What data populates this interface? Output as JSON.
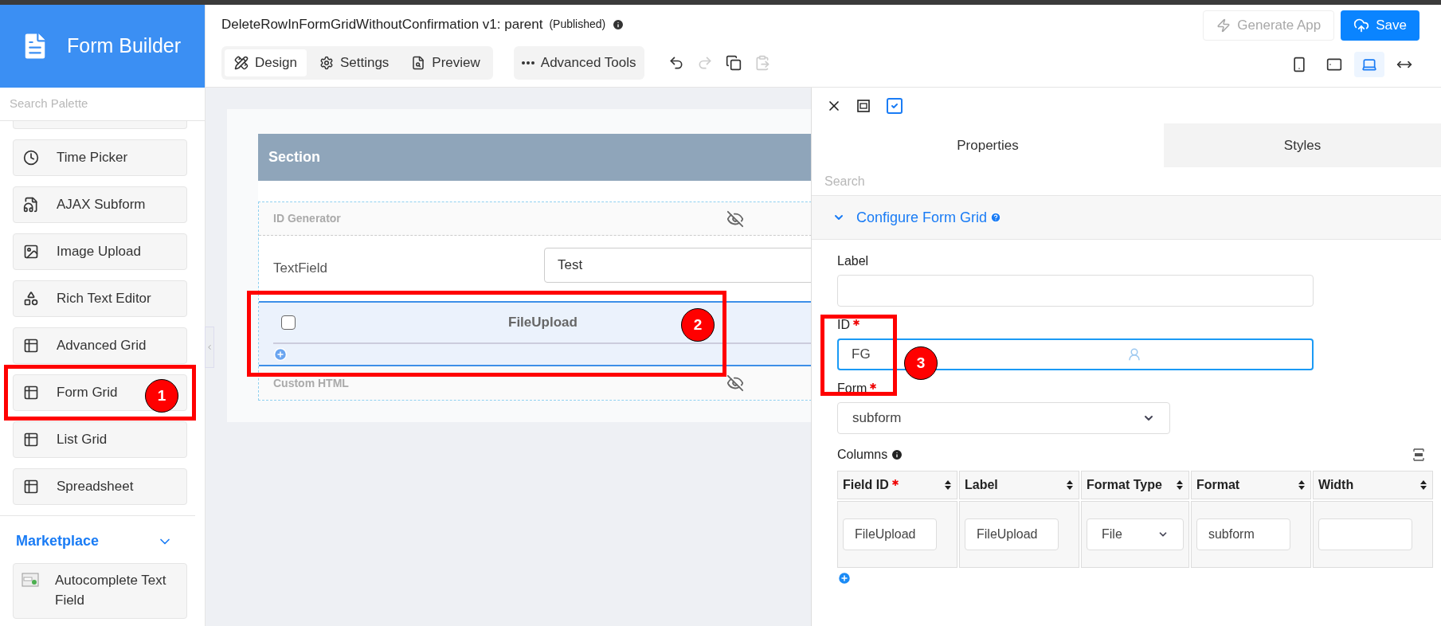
{
  "header": {
    "app_name": "Form Builder",
    "title": "DeleteRowInFormGridWithoutConfirmation v1: parent",
    "status": "(Published)"
  },
  "mode_tabs": [
    {
      "label": "Design",
      "selected": true
    },
    {
      "label": "Settings",
      "selected": false
    },
    {
      "label": "Preview",
      "selected": false
    }
  ],
  "advanced_tools": "Advanced Tools",
  "history_tools": [
    {
      "disabled": false
    },
    {
      "disabled": true
    },
    {
      "disabled": false
    },
    {
      "disabled": true
    }
  ],
  "actions": [
    {
      "label": "Generate App",
      "kind": "generate",
      "disabled": true
    },
    {
      "label": "Save",
      "kind": "save",
      "disabled": false
    }
  ],
  "devices": [
    {
      "selected": false
    },
    {
      "selected": false
    },
    {
      "selected": true
    },
    {
      "selected": false
    }
  ],
  "palette": {
    "search_placeholder": "Search Palette",
    "items": [
      {
        "label": "Time Picker"
      },
      {
        "label": "AJAX Subform"
      },
      {
        "label": "Image Upload"
      },
      {
        "label": "Rich Text Editor"
      },
      {
        "label": "Advanced Grid"
      },
      {
        "label": "Form Grid"
      },
      {
        "label": "List Grid"
      },
      {
        "label": "Spreadsheet"
      }
    ],
    "marketplace": {
      "title": "Marketplace",
      "expanded": true,
      "items": [
        {
          "label": "Autocomplete Text Field"
        }
      ]
    }
  },
  "canvas": {
    "section_title": "Section",
    "fields": [
      {
        "kind": "hidden",
        "label": "ID Generator"
      },
      {
        "kind": "text",
        "label": "TextField",
        "value": "Test"
      },
      {
        "kind": "grid",
        "label": "FileUpload",
        "checked": false,
        "selected": true
      },
      {
        "kind": "hidden",
        "label": "Custom HTML"
      }
    ]
  },
  "properties": {
    "tabs": [
      {
        "label": "Properties",
        "selected": true
      },
      {
        "label": "Styles",
        "selected": false
      }
    ],
    "search_placeholder": "Search",
    "group": {
      "title": "Configure Form Grid",
      "expanded": true
    },
    "fields": [
      {
        "kind": "text",
        "label": "Label",
        "required": false,
        "focused": false
      },
      {
        "kind": "text",
        "label": "ID",
        "required": true,
        "value": "FG",
        "focused": true
      },
      {
        "kind": "select",
        "label": "Form",
        "required": true,
        "value": "subform",
        "focused": false
      }
    ],
    "columns": {
      "label": "Columns",
      "headers": [
        {
          "label": "Field ID",
          "required": true
        },
        {
          "label": "Label",
          "required": false
        },
        {
          "label": "Format Type",
          "required": false
        },
        {
          "label": "Format",
          "required": false
        },
        {
          "label": "Width",
          "required": false
        }
      ],
      "rows": [
        [
          {
            "kind": "input",
            "value": "FileUpload"
          },
          {
            "kind": "input",
            "value": "FileUpload"
          },
          {
            "kind": "select",
            "value": "File"
          },
          {
            "kind": "input",
            "value": "subform"
          },
          {
            "kind": "input"
          }
        ]
      ]
    }
  },
  "annotations": [
    {
      "number": "1"
    },
    {
      "number": "2"
    },
    {
      "number": "3"
    }
  ]
}
